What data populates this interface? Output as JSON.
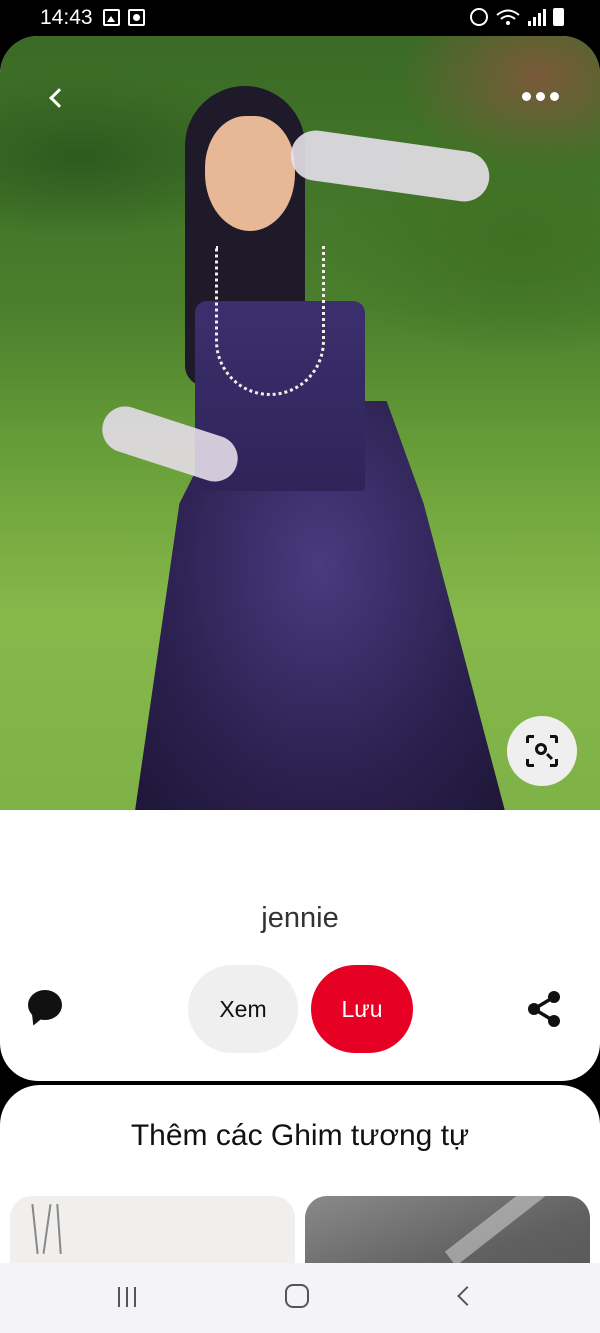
{
  "status_bar": {
    "time": "14:43",
    "left_icons": [
      "image-icon",
      "camera-icon"
    ],
    "right_icons": [
      "alarm-icon",
      "wifi-icon",
      "signal-icon",
      "battery-icon"
    ]
  },
  "pin": {
    "title": "jennie",
    "image_alt_name": "pin-image",
    "actions": {
      "view_label": "Xem",
      "save_label": "Lưu"
    },
    "icons": {
      "back": "chevron-left-icon",
      "more": "more-dots-icon",
      "visual_search": "visual-search-icon",
      "comment": "comment-bubble-icon",
      "share": "share-icon"
    }
  },
  "more_pins": {
    "title": "Thêm các Ghim tương tự"
  },
  "colors": {
    "save_button": "#e60023",
    "view_button": "#efefef",
    "background": "#ffffff"
  },
  "nav_bar": {
    "icons": [
      "recent-apps-icon",
      "home-icon",
      "back-icon"
    ]
  }
}
